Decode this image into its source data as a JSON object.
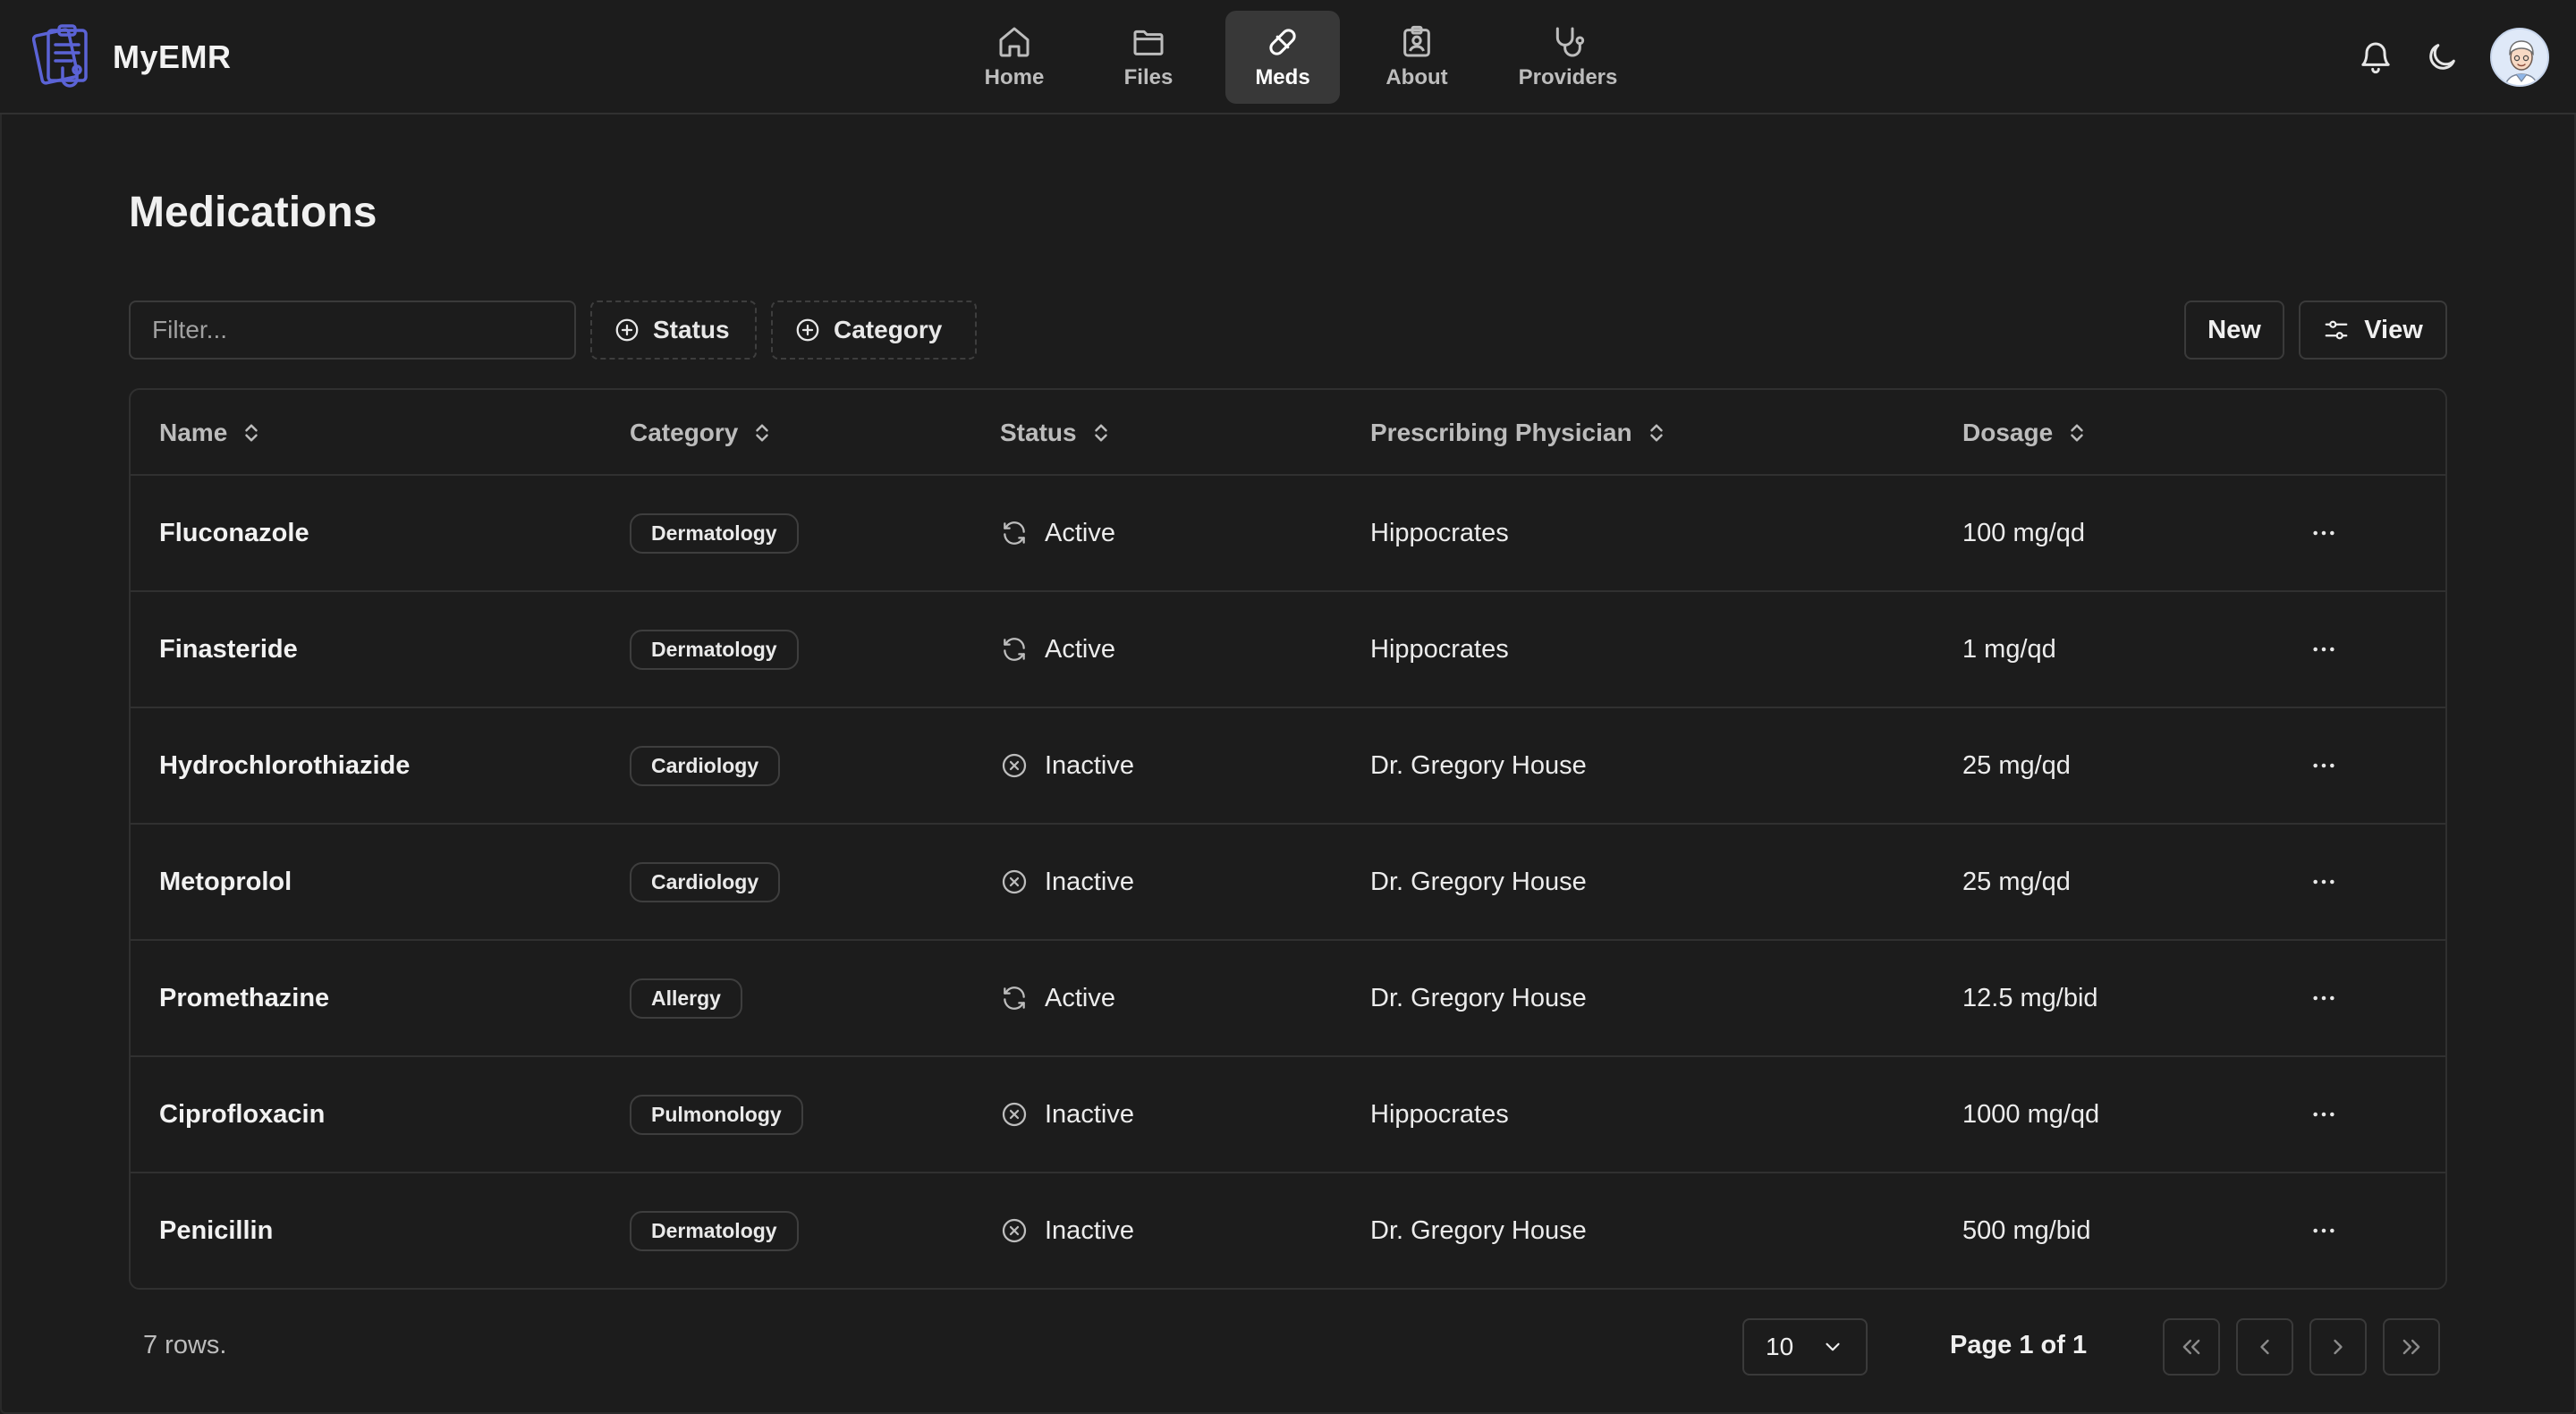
{
  "app": {
    "name": "MyEMR"
  },
  "nav": [
    {
      "label": "Home",
      "icon": "home-icon",
      "active": false
    },
    {
      "label": "Files",
      "icon": "folder-icon",
      "active": false
    },
    {
      "label": "Meds",
      "icon": "pill-icon",
      "active": true
    },
    {
      "label": "About",
      "icon": "id-badge-icon",
      "active": false
    },
    {
      "label": "Providers",
      "icon": "stethoscope-icon",
      "active": false
    }
  ],
  "page": {
    "title": "Medications"
  },
  "toolbar": {
    "filter_placeholder": "Filter...",
    "status_facet": "Status",
    "category_facet": "Category",
    "new_label": "New",
    "view_label": "View"
  },
  "table": {
    "columns": [
      "Name",
      "Category",
      "Status",
      "Prescribing Physician",
      "Dosage"
    ],
    "rows": [
      {
        "name": "Fluconazole",
        "category": "Dermatology",
        "status": "Active",
        "physician": "Hippocrates",
        "dosage": "100 mg/qd"
      },
      {
        "name": "Finasteride",
        "category": "Dermatology",
        "status": "Active",
        "physician": "Hippocrates",
        "dosage": "1 mg/qd"
      },
      {
        "name": "Hydrochlorothiazide",
        "category": "Cardiology",
        "status": "Inactive",
        "physician": "Dr. Gregory House",
        "dosage": "25 mg/qd"
      },
      {
        "name": "Metoprolol",
        "category": "Cardiology",
        "status": "Inactive",
        "physician": "Dr. Gregory House",
        "dosage": "25 mg/qd"
      },
      {
        "name": "Promethazine",
        "category": "Allergy",
        "status": "Active",
        "physician": "Dr. Gregory House",
        "dosage": "12.5 mg/bid"
      },
      {
        "name": "Ciprofloxacin",
        "category": "Pulmonology",
        "status": "Inactive",
        "physician": "Hippocrates",
        "dosage": "1000 mg/qd"
      },
      {
        "name": "Penicillin",
        "category": "Dermatology",
        "status": "Inactive",
        "physician": "Dr. Gregory House",
        "dosage": "500 mg/bid"
      }
    ]
  },
  "footer": {
    "row_count": "7 rows.",
    "page_size": "10",
    "page_info": "Page 1 of 1"
  }
}
